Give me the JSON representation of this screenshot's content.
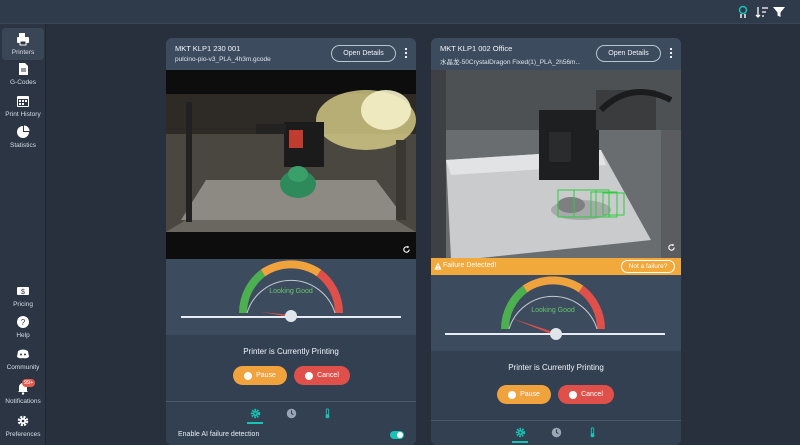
{
  "nav": {
    "items": [
      {
        "label": "Printers",
        "icon": "printer-icon"
      },
      {
        "label": "G-Codes",
        "icon": "file-icon"
      },
      {
        "label": "Print History",
        "icon": "calendar-icon"
      },
      {
        "label": "Statistics",
        "icon": "pie-chart-icon"
      },
      {
        "label": "Pricing",
        "icon": "dollar-icon"
      },
      {
        "label": "Help",
        "icon": "help-icon"
      },
      {
        "label": "Community",
        "icon": "discord-icon"
      },
      {
        "label": "Notifications",
        "icon": "bell-icon",
        "badge": "99+"
      },
      {
        "label": "Preferences",
        "icon": "gear-icon"
      }
    ]
  },
  "colors": {
    "accent": "#17c3b2",
    "pause": "#f0a23d",
    "cancel": "#e0504a",
    "warning": "#f2a93b",
    "good": "#66c56a"
  },
  "printers": [
    {
      "name": "MKT KLP1 230 001",
      "file": "pulcino-pio-v3_PLA_4h3m.gcode",
      "open_label": "Open Details",
      "gauge_label": "Looking Good",
      "status": "Printer is Currently Printing",
      "pause_label": "Pause",
      "cancel_label": "Cancel",
      "ai_label": "Enable AI failure detection"
    },
    {
      "name": "MKT KLP1 002 Office",
      "file": "水晶龙-50CrystalDragon Fixed(1)_PLA_2h56m...",
      "open_label": "Open Details",
      "failure_text": "Failure Detected!",
      "not_failure_label": "Not a failure?",
      "gauge_label": "Looking Good",
      "status": "Printer is Currently Printing",
      "pause_label": "Pause",
      "cancel_label": "Cancel"
    }
  ]
}
